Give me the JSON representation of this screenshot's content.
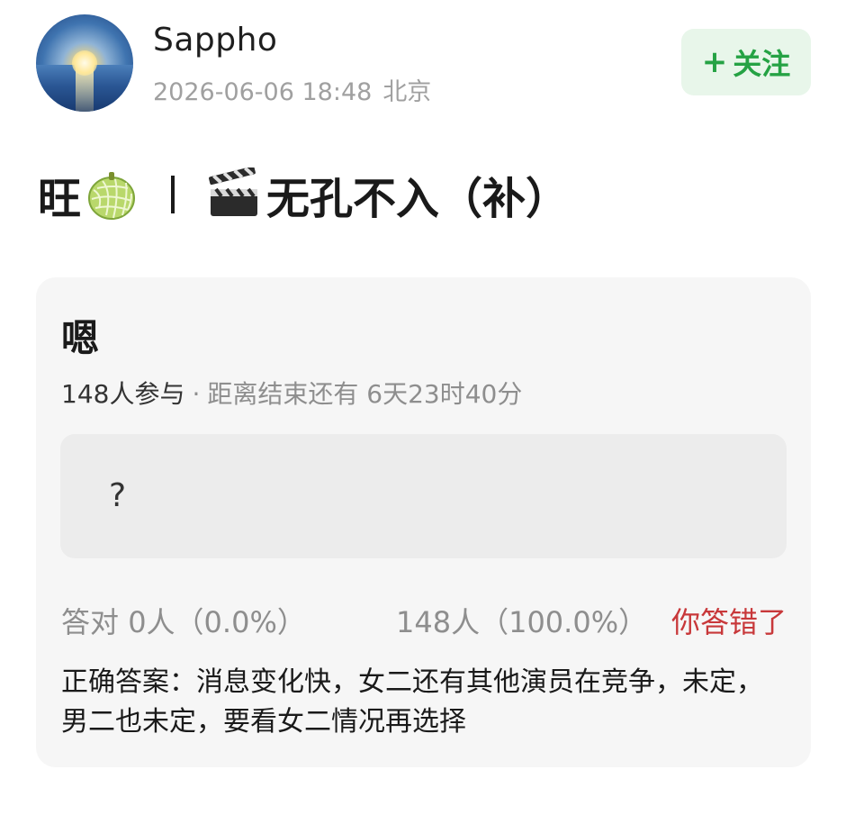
{
  "post": {
    "username": "Sappho",
    "datetime": "2026-06-06 18:48",
    "location": "北京",
    "follow_label": "关注",
    "follow_plus": "+",
    "title_prefix": "旺",
    "title_separator": "|",
    "title_main": "无孔不入（补）",
    "title_emojis": [
      "melon",
      "clapper-board"
    ]
  },
  "quiz": {
    "question": "嗯",
    "participants": "148人参与",
    "time_left_label": "距离结束还有",
    "time_left_value": "6天23时40分",
    "option_text": "?",
    "correct_label": "答对",
    "correct_value": "0人（0.0%）",
    "other_value": "148人（100.0%）",
    "status_text": "你答错了",
    "answer_text": "正确答案：消息变化快，女二还有其他演员在竞争，未定，男二也未定，要看女二情况再选择"
  },
  "colors": {
    "follow_bg": "#e8f6ea",
    "follow_text": "#25a244",
    "wrong_text": "#c8383a",
    "card_bg": "#f6f6f6"
  }
}
